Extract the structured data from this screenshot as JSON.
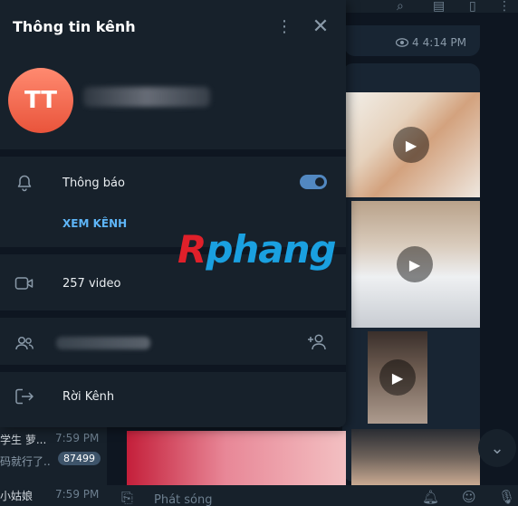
{
  "background": {
    "message_views": "4",
    "message_time": "4:14 PM",
    "chat_list": [
      {
        "name": "学生 萝...",
        "time": "7:59 PM",
        "preview": "码就行了...",
        "unread": "87499"
      },
      {
        "name": "小姑娘",
        "time": "7:59 PM"
      }
    ],
    "composer_placeholder": "Phát sóng"
  },
  "panel": {
    "title": "Thông tin kênh",
    "avatar_initials": "TT",
    "avatar_color": "#e9543b",
    "notifications_label": "Thông báo",
    "notifications_enabled": true,
    "view_channel_label": "XEM KÊNH",
    "video_count_label": "257 video",
    "leave_label": "Rời Kênh"
  },
  "watermark": {
    "first": "R",
    "rest": "phang"
  },
  "colors": {
    "accent": "#5288c1",
    "link": "#5eb5f7",
    "panel_bg": "#17212b",
    "app_bg": "#0e1621"
  }
}
